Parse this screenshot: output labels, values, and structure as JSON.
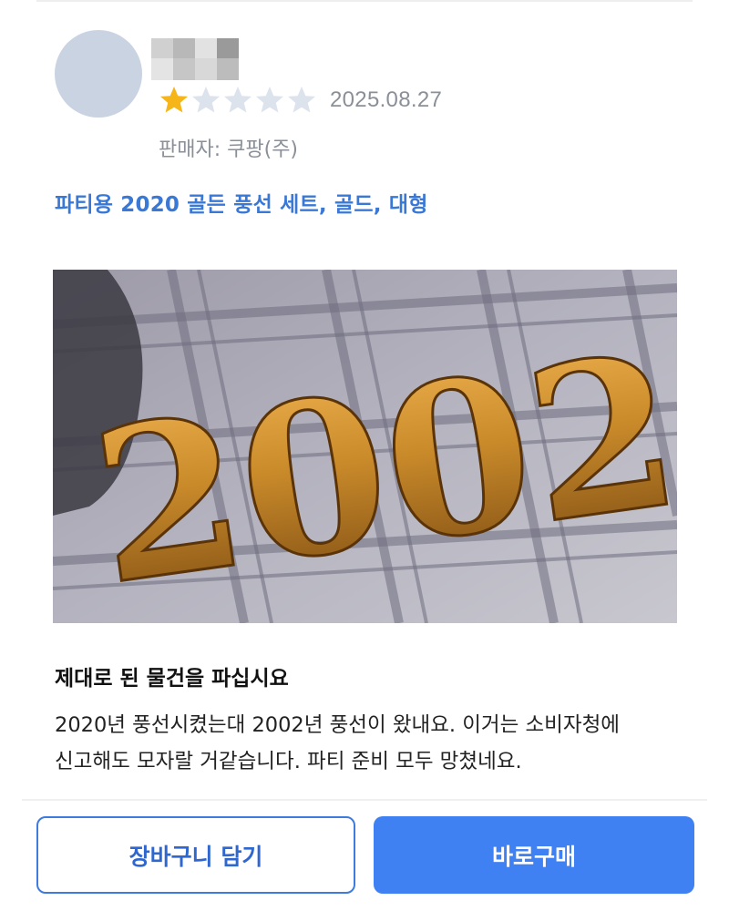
{
  "review": {
    "rating": 1,
    "max_rating": 5,
    "date": "2025.08.27",
    "seller": "판매자: 쿠팡(주)",
    "product_option": "파티용 2020 골든 풍선 세트, 골드, 대형",
    "photo_numbers": "2002",
    "title": "제대로 된 물건을 파십시요",
    "body_lines": [
      "2020년 풍선시켰는대 2002년 풍선이 왔내요. 이거는 소비자청에",
      "신고해도 모자랄 거같습니다. 파티 준비 모두 망쳤네요."
    ]
  },
  "buttons": {
    "cart": "장바구니 담기",
    "buy": "바로구매"
  },
  "colors": {
    "star_filled": "#f6b519",
    "star_empty": "#dde3ec",
    "link_blue": "#3a78d6",
    "primary_button": "#3f80f2",
    "avatar": "#c9d3e2",
    "balloon_gold": "#c98a2a"
  }
}
